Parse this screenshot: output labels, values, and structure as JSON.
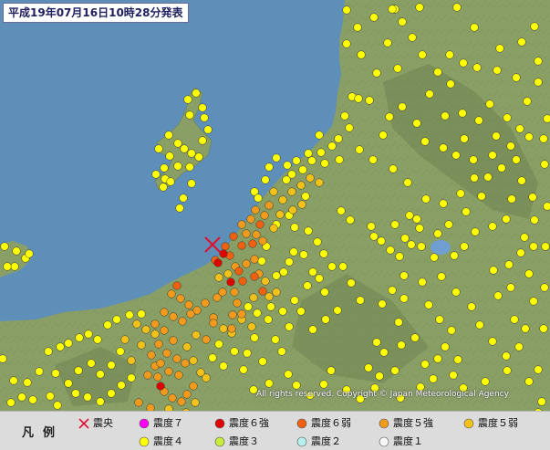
{
  "map": {
    "title": "平成19年07月16日10時28分発表",
    "copyright": "All rights reserved. Copyright © Japan Meteorological Agency",
    "colors": {
      "sea": "#5e8fb9",
      "land": "#8a9f66",
      "mountain": "#6d8150",
      "lake": "#6f9fd0",
      "epicenter": "#e01030"
    },
    "epicenter_symbol": "cross-icon",
    "epicenter": [
      233,
      268
    ]
  },
  "legend": {
    "title": "凡例",
    "items": [
      {
        "label": "震央",
        "color": "#e01030",
        "symbol": "cross"
      },
      {
        "label": "震度７",
        "color": "#ff00ff",
        "symbol": "dot"
      },
      {
        "label": "震度６強",
        "color": "#e00000",
        "symbol": "dot"
      },
      {
        "label": "震度６弱",
        "color": "#f06010",
        "symbol": "dot"
      },
      {
        "label": "震度５強",
        "color": "#f29a1e",
        "symbol": "dot"
      },
      {
        "label": "震度５弱",
        "color": "#f2c21a",
        "symbol": "dot"
      },
      {
        "label": "震度４",
        "color": "#ffff00",
        "symbol": "dot"
      },
      {
        "label": "震度３",
        "color": "#c6ec3c",
        "symbol": "dot"
      },
      {
        "label": "震度２",
        "color": "#b8f0f0",
        "symbol": "dot"
      },
      {
        "label": "震度１",
        "color": "#f7f7f7",
        "symbol": "dot"
      }
    ]
  },
  "stations": {
    "6+": [
      [
        239,
        288
      ],
      [
        245,
        278
      ],
      [
        253,
        309
      ],
      [
        176,
        423
      ]
    ],
    "6-": [
      [
        236,
        285
      ],
      [
        247,
        270
      ],
      [
        256,
        259
      ],
      [
        265,
        269
      ],
      [
        262,
        297
      ],
      [
        266,
        308
      ],
      [
        279,
        303
      ],
      [
        288,
        319
      ],
      [
        252,
        280
      ],
      [
        277,
        267
      ],
      [
        285,
        246
      ],
      [
        194,
        313
      ]
    ],
    "5+": [
      [
        265,
        246
      ],
      [
        275,
        240
      ],
      [
        280,
        230
      ],
      [
        290,
        236
      ],
      [
        295,
        225
      ],
      [
        270,
        256
      ],
      [
        281,
        257
      ],
      [
        288,
        264
      ],
      [
        258,
        292
      ],
      [
        270,
        289
      ],
      [
        279,
        284
      ],
      [
        284,
        300
      ],
      [
        257,
        320
      ],
      [
        260,
        332
      ],
      [
        238,
        326
      ],
      [
        244,
        320
      ],
      [
        188,
        322
      ],
      [
        198,
        327
      ],
      [
        207,
        334
      ],
      [
        216,
        340
      ],
      [
        225,
        332
      ],
      [
        180,
        342
      ],
      [
        190,
        347
      ],
      [
        200,
        352
      ],
      [
        170,
        355
      ],
      [
        180,
        362
      ],
      [
        190,
        373
      ],
      [
        174,
        377
      ],
      [
        166,
        389
      ],
      [
        183,
        387
      ],
      [
        194,
        393
      ],
      [
        203,
        398
      ],
      [
        185,
        407
      ],
      [
        196,
        411
      ],
      [
        173,
        413
      ],
      [
        180,
        429
      ],
      [
        189,
        436
      ],
      [
        199,
        440
      ],
      [
        165,
        447
      ],
      [
        152,
        441
      ],
      [
        162,
        411
      ],
      [
        170,
        401
      ],
      [
        176,
        398
      ],
      [
        209,
        344
      ],
      [
        234,
        348
      ],
      [
        255,
        345
      ],
      [
        265,
        344
      ],
      [
        254,
        360
      ],
      [
        226,
        372
      ],
      [
        212,
        423
      ],
      [
        205,
        432
      ],
      [
        234,
        354
      ]
    ],
    "5-": [
      [
        300,
        250
      ],
      [
        310,
        219
      ],
      [
        320,
        210
      ],
      [
        330,
        203
      ],
      [
        340,
        195
      ],
      [
        300,
        210
      ],
      [
        350,
        200
      ],
      [
        321,
        230
      ],
      [
        331,
        224
      ],
      [
        307,
        235
      ],
      [
        240,
        304
      ],
      [
        250,
        300
      ],
      [
        291,
        308
      ],
      [
        295,
        325
      ],
      [
        303,
        320
      ],
      [
        278,
        326
      ],
      [
        265,
        350
      ],
      [
        276,
        358
      ],
      [
        205,
        380
      ],
      [
        215,
        367
      ],
      [
        245,
        360
      ],
      [
        254,
        365
      ],
      [
        150,
        355
      ],
      [
        160,
        361
      ],
      [
        137,
        372
      ],
      [
        170,
        366
      ],
      [
        144,
        395
      ],
      [
        155,
        378
      ],
      [
        220,
        408
      ],
      [
        212,
        395
      ],
      [
        226,
        414
      ],
      [
        204,
        452
      ],
      [
        214,
        441
      ],
      [
        185,
        448
      ]
    ],
    "4": [
      [
        206,
        109
      ],
      [
        215,
        102
      ],
      [
        195,
        157
      ],
      [
        202,
        163
      ],
      [
        186,
        171
      ],
      [
        210,
        168
      ],
      [
        195,
        182
      ],
      [
        222,
        154
      ],
      [
        174,
        163
      ],
      [
        181,
        196
      ],
      [
        179,
        205
      ],
      [
        187,
        199
      ],
      [
        208,
        183
      ],
      [
        218,
        172
      ],
      [
        295,
        183
      ],
      [
        303,
        173
      ],
      [
        315,
        181
      ],
      [
        320,
        191
      ],
      [
        332,
        186
      ],
      [
        342,
        176
      ],
      [
        352,
        167
      ],
      [
        356,
        179
      ],
      [
        364,
        160
      ],
      [
        371,
        152
      ],
      [
        378,
        127
      ],
      [
        383,
        140
      ],
      [
        386,
        106
      ],
      [
        393,
        108
      ],
      [
        394,
        164
      ],
      [
        372,
        175
      ],
      [
        384,
        241
      ],
      [
        374,
        231
      ],
      [
        407,
        248
      ],
      [
        410,
        259
      ],
      [
        418,
        264
      ],
      [
        428,
        274
      ],
      [
        438,
        281
      ],
      [
        433,
        246
      ],
      [
        444,
        261
      ],
      [
        449,
        236
      ],
      [
        457,
        240
      ],
      [
        460,
        250
      ],
      [
        451,
        268
      ],
      [
        462,
        270
      ],
      [
        443,
        302
      ],
      [
        430,
        318
      ],
      [
        443,
        327
      ],
      [
        419,
        333
      ],
      [
        413,
        375
      ],
      [
        421,
        386
      ],
      [
        404,
        403
      ],
      [
        416,
        412
      ],
      [
        433,
        406
      ],
      [
        440,
        378
      ],
      [
        437,
        353
      ],
      [
        455,
        370
      ],
      [
        466,
        399
      ],
      [
        480,
        393
      ],
      [
        488,
        380
      ],
      [
        502,
        394
      ],
      [
        495,
        362
      ],
      [
        482,
        350
      ],
      [
        470,
        334
      ],
      [
        463,
        309
      ],
      [
        484,
        303
      ],
      [
        500,
        320
      ],
      [
        395,
        329
      ],
      [
        385,
        310
      ],
      [
        376,
        292
      ],
      [
        364,
        292
      ],
      [
        355,
        278
      ],
      [
        348,
        265
      ],
      [
        338,
        253
      ],
      [
        323,
        249
      ],
      [
        333,
        279
      ],
      [
        356,
        320
      ],
      [
        370,
        340
      ],
      [
        357,
        350
      ],
      [
        343,
        361
      ],
      [
        330,
        341
      ],
      [
        317,
        358
      ],
      [
        302,
        372
      ],
      [
        309,
        385
      ],
      [
        288,
        396
      ],
      [
        271,
        387
      ],
      [
        279,
        370
      ],
      [
        257,
        385
      ],
      [
        245,
        401
      ],
      [
        233,
        392
      ],
      [
        240,
        377
      ],
      [
        267,
        405
      ],
      [
        278,
        427
      ],
      [
        295,
        420
      ],
      [
        316,
        410
      ],
      [
        325,
        422
      ],
      [
        340,
        433
      ],
      [
        355,
        421
      ],
      [
        363,
        406
      ],
      [
        380,
        427
      ],
      [
        395,
        437
      ],
      [
        411,
        425
      ],
      [
        439,
        436
      ],
      [
        461,
        424
      ],
      [
        475,
        415
      ],
      [
        497,
        411
      ],
      [
        508,
        425
      ],
      [
        532,
        418
      ],
      [
        556,
        406
      ],
      [
        580,
        418
      ],
      [
        590,
        405
      ],
      [
        569,
        380
      ],
      [
        564,
        350
      ],
      [
        546,
        324
      ],
      [
        541,
        296
      ],
      [
        558,
        290
      ],
      [
        571,
        277
      ],
      [
        575,
        260
      ],
      [
        555,
        240
      ],
      [
        540,
        248
      ],
      [
        521,
        254
      ],
      [
        509,
        270
      ],
      [
        498,
        280
      ],
      [
        476,
        282
      ],
      [
        480,
        256
      ],
      [
        492,
        246
      ],
      [
        511,
        232
      ],
      [
        528,
        215
      ],
      [
        535,
        194
      ],
      [
        550,
        184
      ],
      [
        566,
        175
      ],
      [
        572,
        198
      ],
      [
        561,
        218
      ],
      [
        584,
        216
      ],
      [
        586,
        241
      ],
      [
        580,
        150
      ],
      [
        570,
        141
      ],
      [
        544,
        149
      ],
      [
        556,
        129
      ],
      [
        578,
        111
      ],
      [
        590,
        90
      ],
      [
        566,
        85
      ],
      [
        545,
        77
      ],
      [
        523,
        74
      ],
      [
        508,
        69
      ],
      [
        494,
        92
      ],
      [
        480,
        79
      ],
      [
        463,
        60
      ],
      [
        452,
        41
      ],
      [
        441,
        24
      ],
      [
        433,
        10
      ],
      [
        425,
        47
      ],
      [
        436,
        75
      ],
      [
        441,
        117
      ],
      [
        427,
        128
      ],
      [
        457,
        135
      ],
      [
        466,
        155
      ],
      [
        486,
        162
      ],
      [
        500,
        170
      ],
      [
        509,
        152
      ],
      [
        525,
        132
      ],
      [
        537,
        114
      ],
      [
        507,
        124
      ],
      [
        488,
        127
      ],
      [
        471,
        103
      ],
      [
        493,
        60
      ],
      [
        501,
        8
      ],
      [
        520,
        30
      ],
      [
        548,
        53
      ],
      [
        572,
        46
      ],
      [
        586,
        29
      ],
      [
        590,
        67
      ],
      [
        600,
        130
      ],
      [
        597,
        180
      ],
      [
        598,
        270
      ],
      [
        597,
        315
      ],
      [
        585,
        330
      ],
      [
        596,
        360
      ],
      [
        430,
        10
      ],
      [
        460,
        8
      ],
      [
        380,
        11
      ],
      [
        410,
        19
      ],
      [
        392,
        30
      ],
      [
        380,
        48
      ],
      [
        396,
        60
      ],
      [
        413,
        80
      ],
      [
        405,
        110
      ],
      [
        420,
        148
      ],
      [
        409,
        175
      ],
      [
        431,
        185
      ],
      [
        447,
        200
      ],
      [
        467,
        218
      ],
      [
        486,
        223
      ],
      [
        505,
        212
      ],
      [
        520,
        195
      ],
      [
        519,
        175
      ],
      [
        540,
        170
      ],
      [
        560,
        160
      ],
      [
        596,
        152
      ],
      [
        600,
        226
      ],
      [
        585,
        270
      ],
      [
        580,
        300
      ],
      [
        560,
        315
      ],
      [
        517,
        336
      ],
      [
        526,
        356
      ],
      [
        540,
        374
      ],
      [
        555,
        390
      ],
      [
        576,
        360
      ],
      [
        594,
        440
      ],
      [
        590,
        452
      ],
      [
        53,
        385
      ],
      [
        66,
        380
      ],
      [
        75,
        376
      ],
      [
        87,
        370
      ],
      [
        97,
        366
      ],
      [
        107,
        372
      ],
      [
        118,
        356
      ],
      [
        128,
        350
      ],
      [
        142,
        345
      ],
      [
        155,
        344
      ],
      [
        61,
        409
      ],
      [
        75,
        420
      ],
      [
        83,
        431
      ],
      [
        24,
        435
      ],
      [
        36,
        438
      ],
      [
        12,
        441
      ],
      [
        96,
        435
      ],
      [
        110,
        440
      ],
      [
        122,
        431
      ],
      [
        133,
        422
      ],
      [
        144,
        414
      ],
      [
        122,
        400
      ],
      [
        110,
        410
      ],
      [
        132,
        385
      ],
      [
        100,
        398
      ],
      [
        86,
        406
      ],
      [
        43,
        407
      ],
      [
        55,
        434
      ],
      [
        63,
        444
      ],
      [
        3,
        393
      ],
      [
        15,
        417
      ],
      [
        30,
        419
      ],
      [
        18,
        275
      ],
      [
        28,
        283
      ],
      [
        32,
        278
      ],
      [
        16,
        292
      ],
      [
        8,
        292
      ],
      [
        5,
        270
      ],
      [
        180,
        184
      ],
      [
        171,
        191
      ],
      [
        228,
        142
      ],
      [
        224,
        129
      ],
      [
        208,
        126
      ],
      [
        222,
        118
      ],
      [
        185,
        148
      ],
      [
        210,
        201
      ],
      [
        201,
        217
      ],
      [
        197,
        228
      ],
      [
        335,
        215
      ],
      [
        317,
        236
      ],
      [
        303,
        246
      ],
      [
        292,
        270
      ],
      [
        287,
        286
      ],
      [
        303,
        302
      ],
      [
        311,
        298
      ],
      [
        317,
        287
      ],
      [
        322,
        276
      ],
      [
        343,
        298
      ],
      [
        350,
        305
      ],
      [
        337,
        313
      ],
      [
        323,
        329
      ],
      [
        310,
        341
      ],
      [
        294,
        350
      ],
      [
        282,
        343
      ],
      [
        272,
        336
      ],
      [
        297,
        336
      ],
      [
        279,
        210
      ],
      [
        283,
        217
      ],
      [
        291,
        197
      ],
      [
        314,
        197
      ],
      [
        325,
        176
      ],
      [
        338,
        168
      ],
      [
        350,
        148
      ]
    ]
  }
}
